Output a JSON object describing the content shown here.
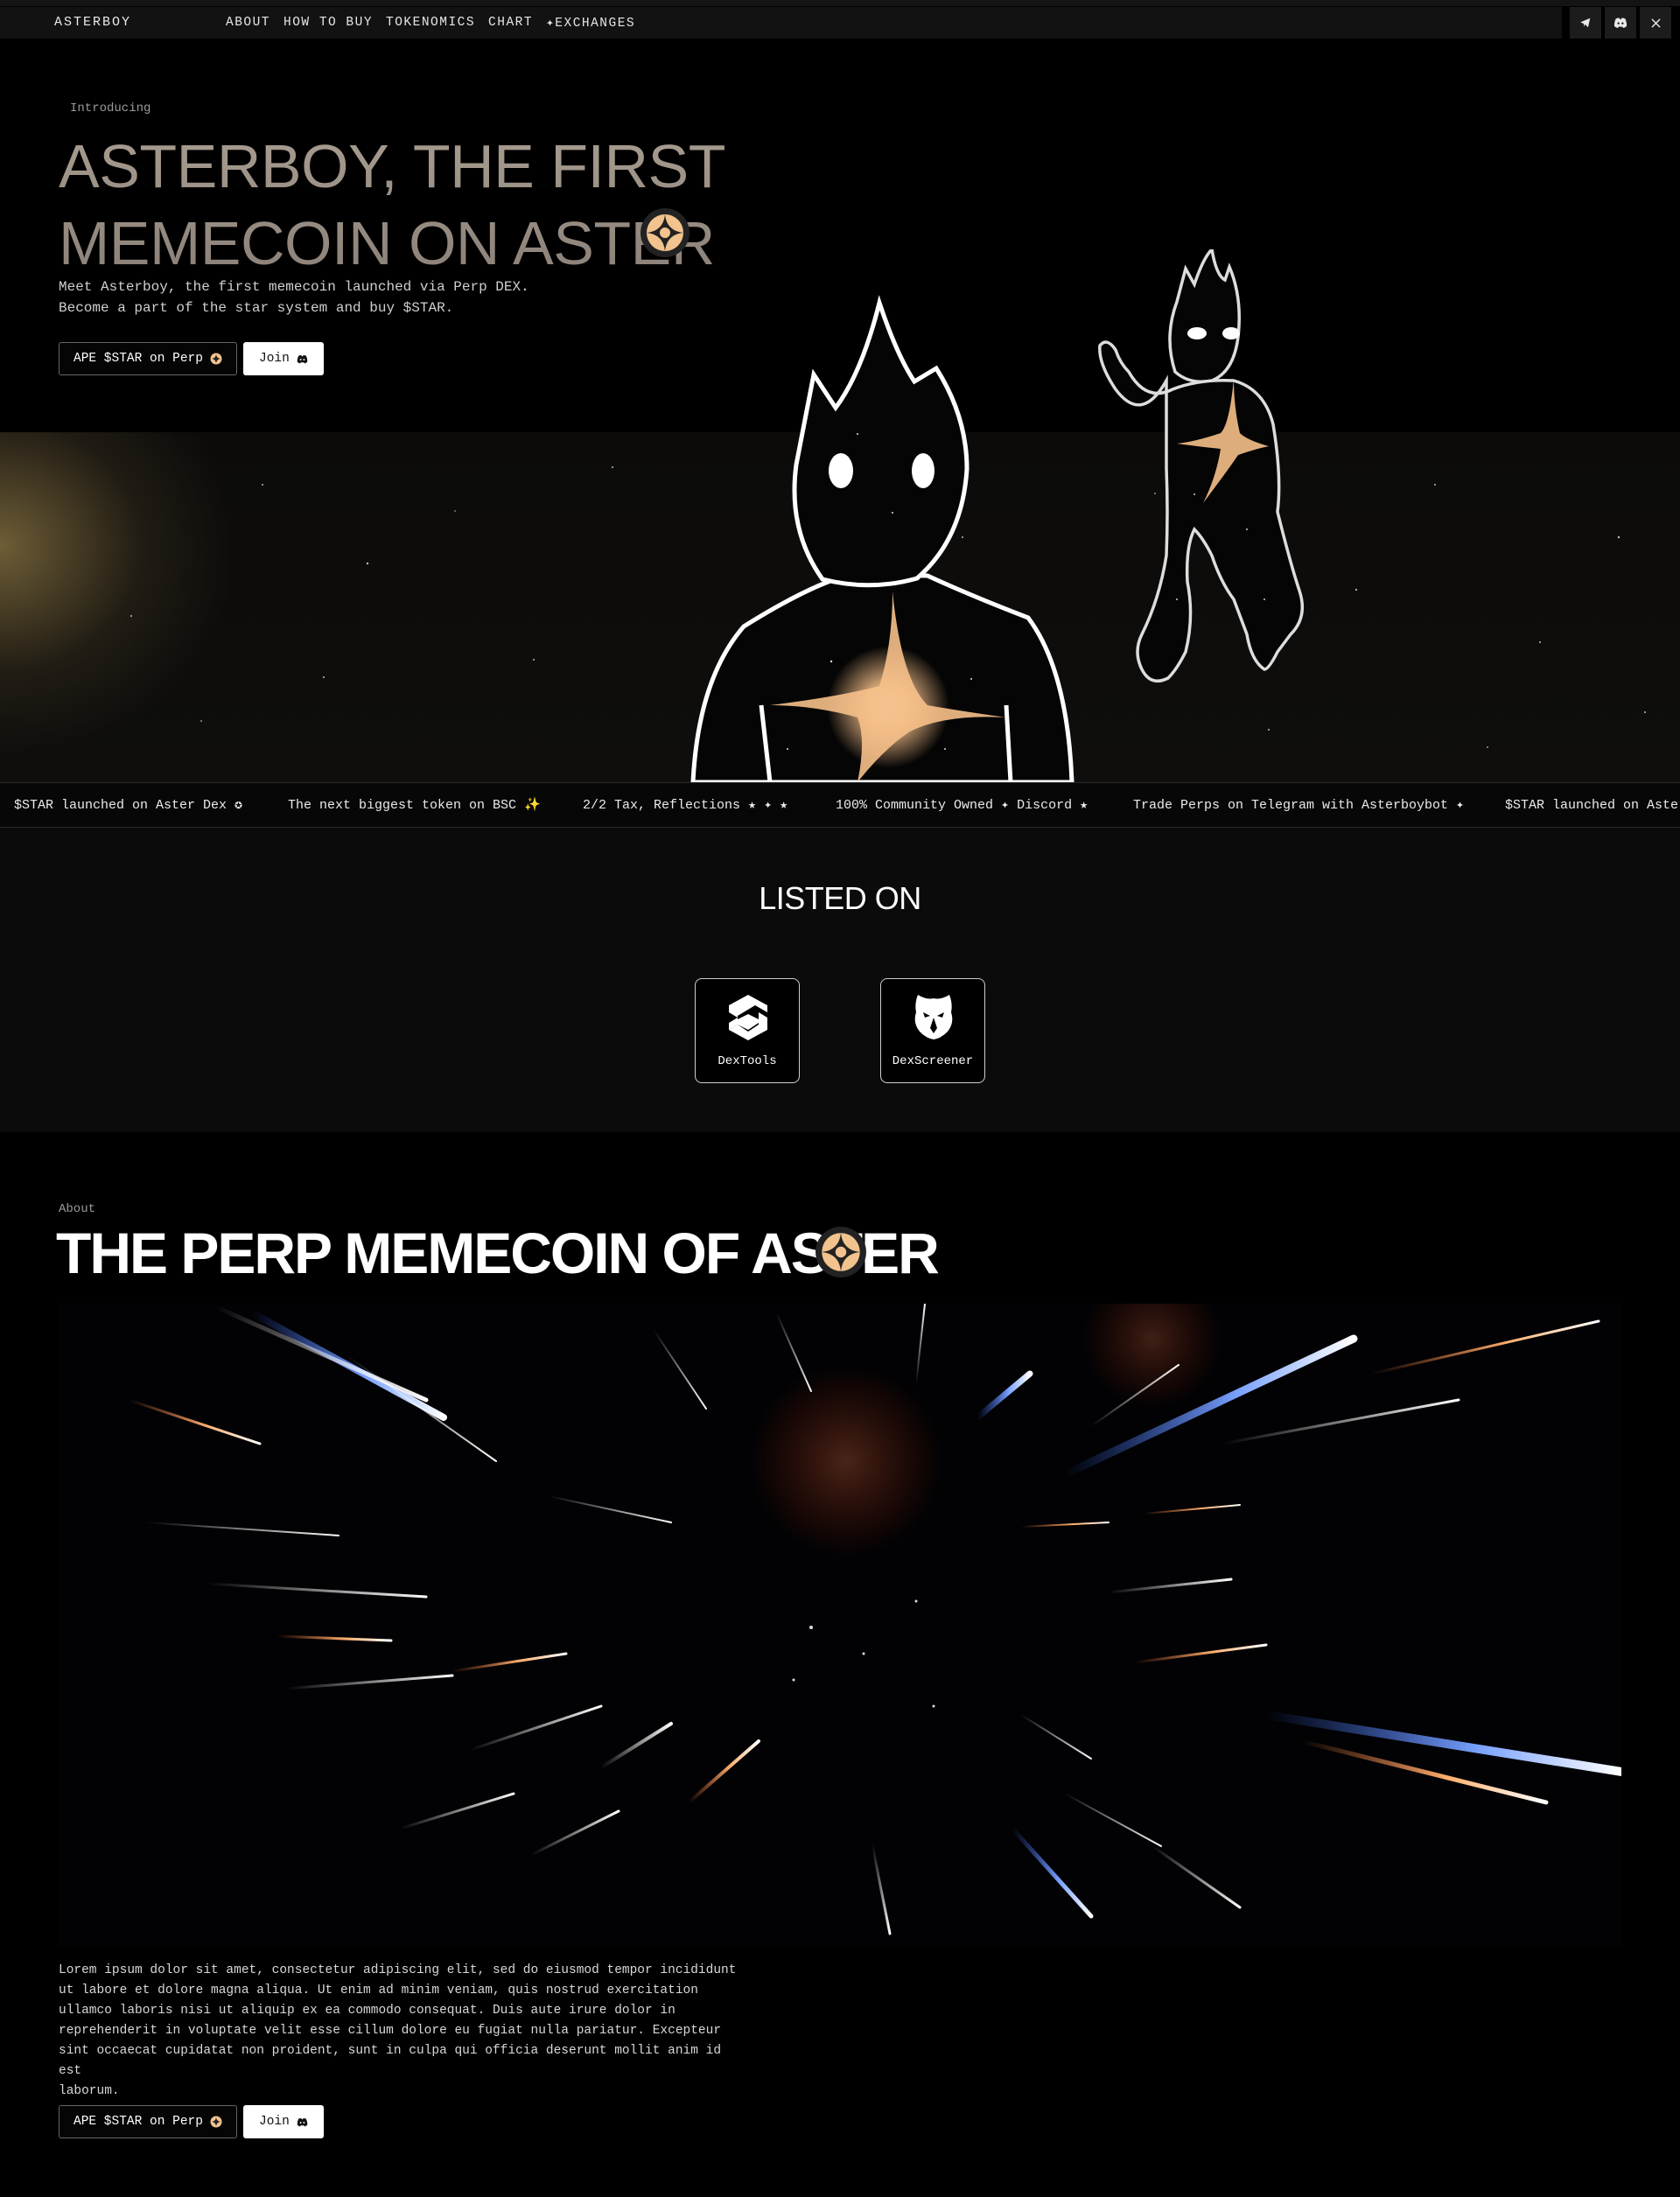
{
  "nav": {
    "brand": "ASTERBOY",
    "links": [
      "ABOUT",
      "HOW TO BUY",
      "TOKENOMICS",
      "CHART",
      "✦EXCHANGES"
    ],
    "social_icons": [
      "telegram-icon",
      "discord-icon",
      "x-icon"
    ]
  },
  "hero": {
    "eyebrow": "Introducing",
    "title_line1": "ASTERBOY, THE FIRST",
    "title_line2": "MEMECOIN ON ASTER",
    "desc_line1": "Meet Asterboy, the first memecoin launched via Perp DEX.",
    "desc_line2": "Become a part of the star system and buy $STAR.",
    "buy_label": "APE $STAR on Perp",
    "join_label": "Join"
  },
  "ticker": {
    "items": [
      "$STAR launched on Aster Dex ✪",
      "The next biggest token on BSC ✨",
      "2/2 Tax, Reflections ★ ✦ ★",
      "100% Community Owned ✦ Discord ★",
      "Trade Perps on Telegram with Asterboybot ✦",
      "$STAR launched on Aster Dex"
    ]
  },
  "listed": {
    "title": "LISTED ON",
    "cards": [
      {
        "label": "DexTools",
        "icon": "dextools-icon"
      },
      {
        "label": "DexScreener",
        "icon": "dexscreener-icon"
      }
    ]
  },
  "about": {
    "eyebrow": "About",
    "title": "THE PERP MEMECOIN OF ASTER",
    "body_lines": [
      "Lorem ipsum dolor sit amet, consectetur adipiscing elit, sed do eiusmod tempor incididunt",
      "ut labore et dolore magna aliqua. Ut enim ad minim veniam, quis nostrud exercitation",
      "ullamco laboris nisi ut aliquip ex ea commodo consequat. Duis aute irure dolor in",
      "reprehenderit in voluptate velit esse cillum dolore eu fugiat nulla pariatur. Excepteur",
      "sint occaecat cupidatat non proident, sunt in culpa qui officia deserunt mollit anim id est",
      "laborum."
    ],
    "buy_label": "APE $STAR on Perp",
    "join_label": "Join"
  },
  "colors": {
    "background": "#000000",
    "nav_bg": "#121212",
    "hero_title": "#a89d90",
    "star_glow": "#f6c08a",
    "listed_bg": "#0b0b0b"
  }
}
